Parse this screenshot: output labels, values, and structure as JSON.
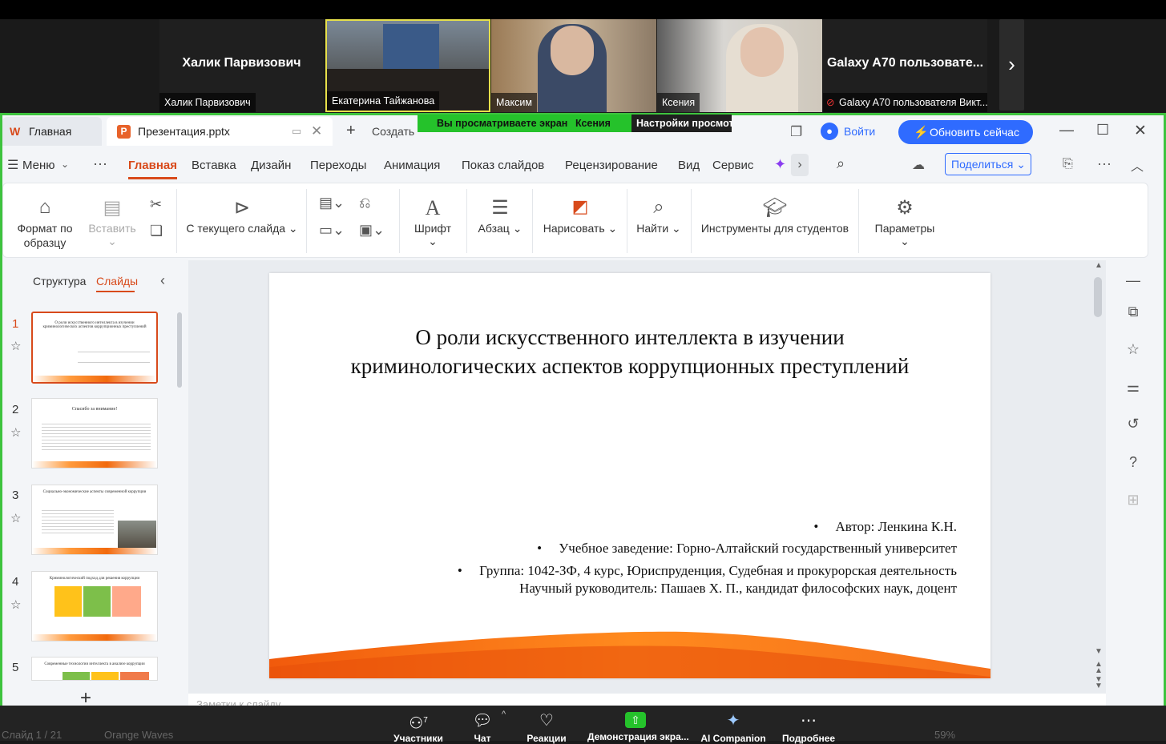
{
  "zoom_top": {
    "tiles": [
      {
        "big_name": "Халик Парвизович",
        "label": "Халик Парвизович"
      },
      {
        "big_name": "",
        "label": "Екатерина Тайжанова"
      },
      {
        "big_name": "",
        "label": "Максим"
      },
      {
        "big_name": "",
        "label": "Ксения"
      },
      {
        "big_name": "Galaxy A70 пользовате...",
        "label": "Galaxy A70 пользователя Викт..."
      }
    ],
    "share_banner": "Вы просматриваете экран",
    "share_user": "Ксения",
    "view_settings": "Настройки просмотра"
  },
  "window": {
    "home_tab": "Главная",
    "file_tab": "Презентация.pptx",
    "create": "Создать",
    "login": "Войти",
    "update": "Обновить сейчас"
  },
  "menu": {
    "menu_label": "Меню",
    "items": [
      "Главная",
      "Вставка",
      "Дизайн",
      "Переходы",
      "Анимация",
      "Показ слайдов",
      "Рецензирование",
      "Вид",
      "Сервис"
    ],
    "share": "Поделиться"
  },
  "ribbon": {
    "format_painter": [
      "Формат по",
      "образцу"
    ],
    "paste": "Вставить",
    "from_current": "С текущего слайда",
    "font": "Шрифт",
    "paragraph": "Абзац",
    "draw": "Нарисовать",
    "find": "Найти",
    "student_tools": "Инструменты для студентов",
    "params": "Параметры"
  },
  "left_panel": {
    "structure": "Структура",
    "slides": "Слайды",
    "thumbs": [
      {
        "num": "1",
        "title": "О роли искусственного интеллекта в изучении криминологических аспектов коррупционных преступлений"
      },
      {
        "num": "2",
        "title": "Спасибо за внимание!"
      },
      {
        "num": "3",
        "title": "Социально-экономические аспекты современной коррупции"
      },
      {
        "num": "4",
        "title": "Криминологический подход для решения коррупции"
      },
      {
        "num": "5",
        "title": "Современные технологии интеллекта в анализе коррупции"
      }
    ]
  },
  "slide": {
    "title_line1": "О роли искусственного интеллекта в изучении",
    "title_line2": "криминологических аспектов коррупционных преступлений",
    "author": "Автор: Ленкина К.Н.",
    "institution": "Учебное заведение: Горно-Алтайский государственный университет",
    "group": "Группа: 1042-ЗФ, 4 курс, Юриспруденция, Судебная и прокурорская деятельность",
    "advisor": "Научный руководитель: Пашаев Х. П., кандидат философских наук, доцент"
  },
  "notes_placeholder": "Заметки к слайду",
  "zoom_bottom": {
    "participants": "Участники",
    "participants_count": "7",
    "chat": "Чат",
    "reactions": "Реакции",
    "share_screen": "Демонстрация экра...",
    "ai": "AI Companion",
    "more": "Подробнее"
  },
  "status": {
    "slide_count": "Слайд 1 / 21",
    "theme": "Orange Waves",
    "zoom": "59%"
  },
  "colors": {
    "accent": "#d84a1b",
    "share_green": "#25c22b",
    "update_blue": "#2f6bff"
  }
}
